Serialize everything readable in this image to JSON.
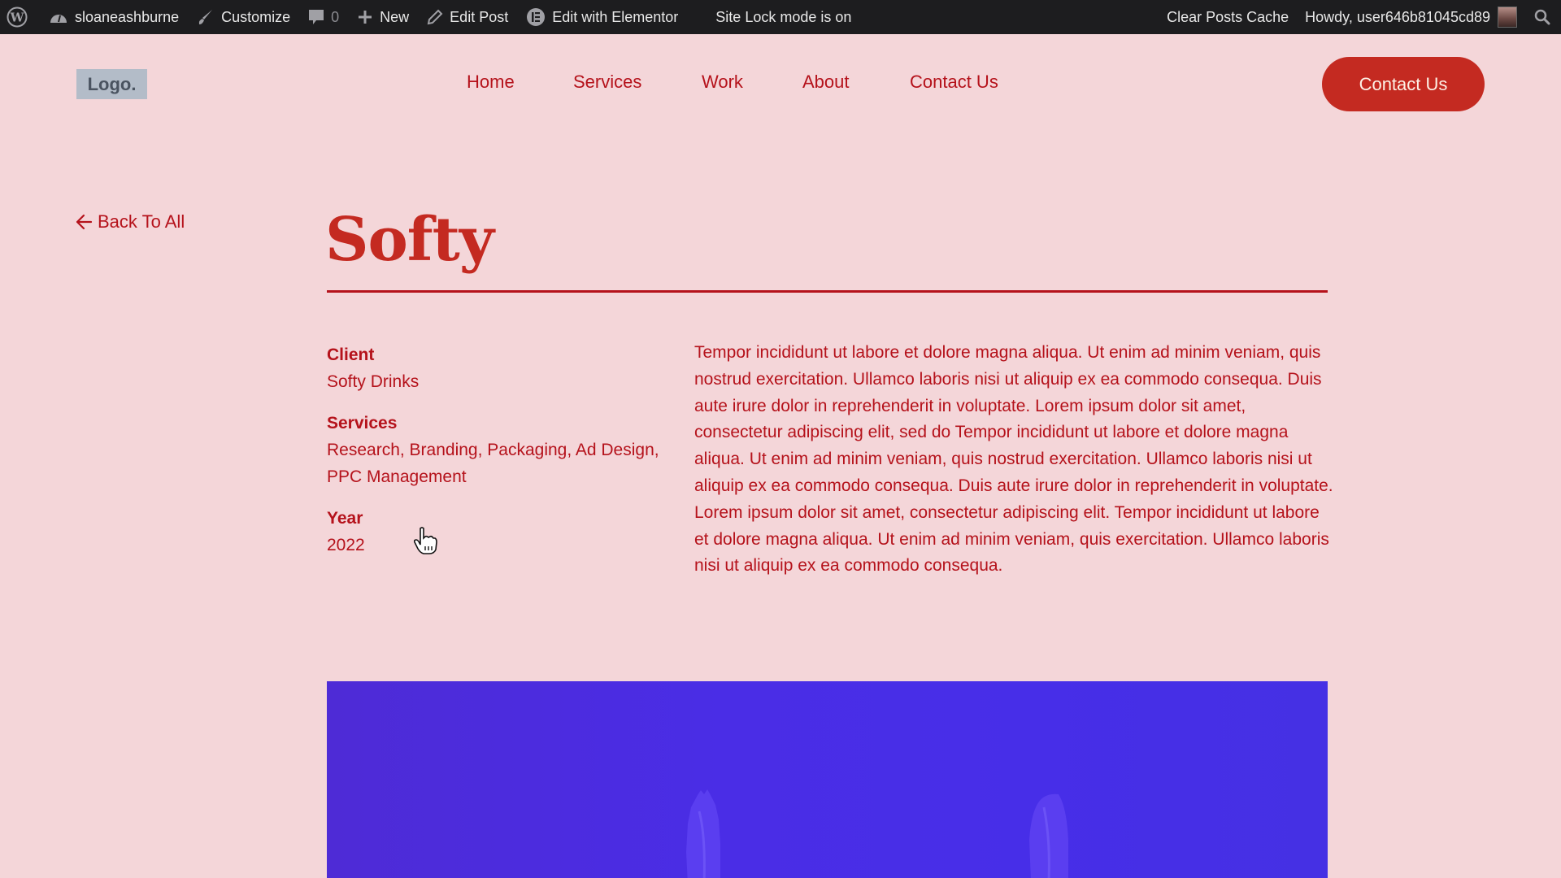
{
  "adminbar": {
    "site_name": "sloaneashburne",
    "customize": "Customize",
    "comments_count": "0",
    "new": "New",
    "edit_post": "Edit Post",
    "edit_elementor": "Edit with Elementor",
    "site_lock": "Site Lock mode is on",
    "clear_cache": "Clear Posts Cache",
    "howdy": "Howdy, user646b81045cd89"
  },
  "header": {
    "logo": "Logo.",
    "nav": [
      {
        "label": "Home"
      },
      {
        "label": "Services"
      },
      {
        "label": "Work"
      },
      {
        "label": "About"
      },
      {
        "label": "Contact Us"
      }
    ],
    "cta": "Contact Us"
  },
  "project": {
    "back_label": "Back To All",
    "title": "Softy",
    "client_label": "Client",
    "client_value": "Softy Drinks",
    "services_label": "Services",
    "services_value": "Research, Branding, Packaging, Ad Design, PPC Management",
    "year_label": "Year",
    "year_value": "2022",
    "description": "Tempor incididunt ut labore et dolore magna aliqua. Ut enim ad minim veniam, quis nostrud exercitation. Ullamco laboris nisi ut aliquip ex ea commodo consequa. Duis aute irure dolor in reprehenderit in voluptate. Lorem ipsum dolor sit amet, consectetur adipiscing elit, sed do Tempor incididunt ut labore et dolore magna aliqua. Ut enim ad minim veniam, quis nostrud exercitation. Ullamco laboris nisi ut aliquip ex ea commodo consequa. Duis aute irure dolor in reprehenderit in voluptate. Lorem ipsum dolor sit amet, consectetur adipiscing elit. Tempor incididunt ut labore et dolore magna aliqua. Ut enim ad minim veniam, quis exercitation. Ullamco laboris nisi ut aliquip ex ea commodo consequa."
  },
  "colors": {
    "background": "#f4d6d9",
    "accent": "#c42a21",
    "text": "#b5121b",
    "hero": "#4a2de6",
    "adminbar": "#1d1d1f"
  }
}
